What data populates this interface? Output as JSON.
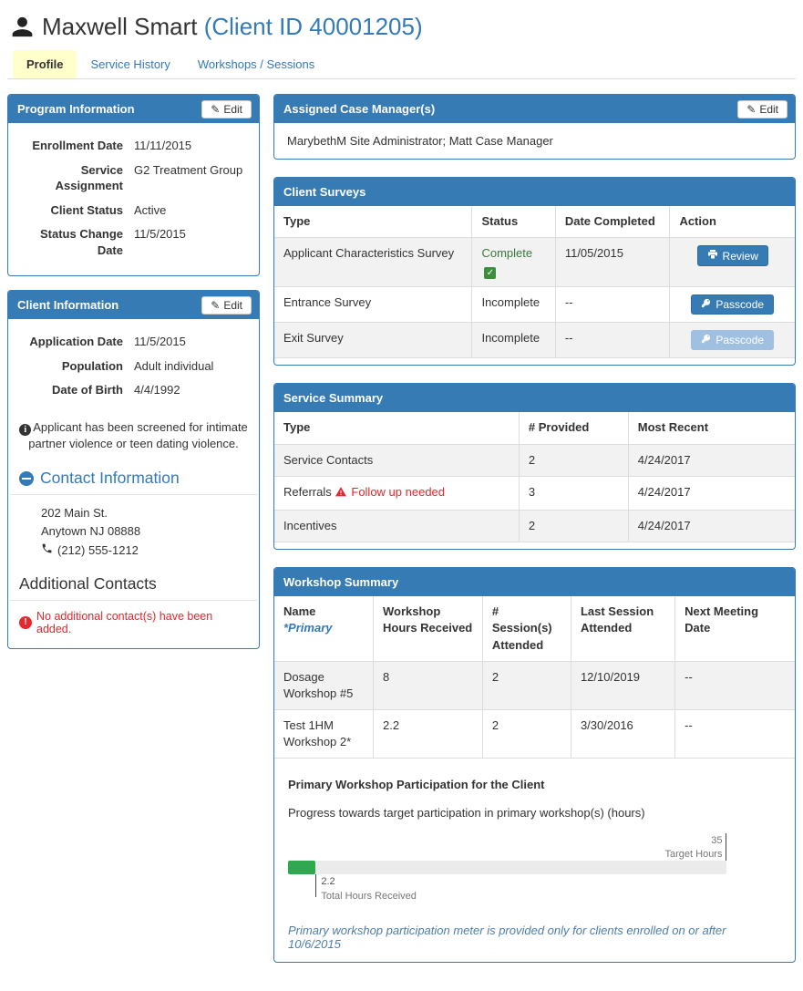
{
  "header": {
    "title": "Maxwell Smart",
    "client_id": "(Client ID 40001205)"
  },
  "tabs": {
    "profile": "Profile",
    "service_history": "Service History",
    "workshops": "Workshops / Sessions"
  },
  "icons": {
    "edit": "✎",
    "check": "✓",
    "info": "i",
    "alert": "!",
    "minus": "minus-circle",
    "user": "person-silhouette",
    "phone": "phone-receiver",
    "review": "printer",
    "passcode": "key",
    "warning": "red-triangle"
  },
  "program_info": {
    "title": "Program Information",
    "edit_label": "Edit",
    "fields": [
      {
        "label": "Enrollment Date",
        "value": "11/11/2015"
      },
      {
        "label": "Service Assignment",
        "value": "G2 Treatment Group"
      },
      {
        "label": "Client Status",
        "value": "Active"
      },
      {
        "label": "Status Change Date",
        "value": "11/5/2015"
      }
    ]
  },
  "client_info": {
    "title": "Client Information",
    "edit_label": "Edit",
    "fields": [
      {
        "label": "Application Date",
        "value": "11/5/2015"
      },
      {
        "label": "Population",
        "value": "Adult individual"
      },
      {
        "label": "Date of Birth",
        "value": "4/4/1992"
      }
    ],
    "screening_note": "Applicant has been screened for intimate partner violence or teen dating violence.",
    "contact": {
      "title": "Contact Information",
      "address_line1": "202 Main St.",
      "address_line2": "Anytown NJ 08888",
      "phone": "(212) 555-1212"
    },
    "additional": {
      "title": "Additional Contacts",
      "empty_message": "No additional contact(s) have been added."
    }
  },
  "case_managers": {
    "title": "Assigned Case Manager(s)",
    "edit_label": "Edit",
    "value": "MarybethM Site Administrator; Matt Case Manager"
  },
  "client_surveys": {
    "title": "Client Surveys",
    "col_type": "Type",
    "col_status": "Status",
    "col_date": "Date Completed",
    "col_action": "Action",
    "rows": [
      {
        "type": "Applicant Characteristics Survey",
        "status": "Complete",
        "date": "11/05/2015",
        "action": "Review"
      },
      {
        "type": "Entrance Survey",
        "status": "Incomplete",
        "date": "--",
        "action": "Passcode"
      },
      {
        "type": "Exit Survey",
        "status": "Incomplete",
        "date": "--",
        "action": "Passcode"
      }
    ]
  },
  "service_summary": {
    "title": "Service Summary",
    "col_type": "Type",
    "col_provided": "# Provided",
    "col_recent": "Most Recent",
    "rows": [
      {
        "type": "Service Contacts",
        "provided": "2",
        "recent": "4/24/2017"
      },
      {
        "type": "Referrals",
        "warning": "Follow up needed",
        "provided": "3",
        "recent": "4/24/2017"
      },
      {
        "type": "Incentives",
        "provided": "2",
        "recent": "4/24/2017"
      }
    ]
  },
  "workshop_summary": {
    "title": "Workshop Summary",
    "col_name": "Name",
    "col_name_note": "*Primary",
    "col_hours": "Workshop Hours Received",
    "col_sessions": "# Session(s) Attended",
    "col_last": "Last Session Attended",
    "col_next": "Next Meeting Date",
    "rows": [
      {
        "name": "Dosage Workshop #5",
        "hours": "8",
        "sessions": "2",
        "last": "12/10/2019",
        "next": "--"
      },
      {
        "name": "Test 1HM Workshop 2*",
        "hours": "2.2",
        "sessions": "2",
        "last": "3/30/2016",
        "next": "--"
      }
    ],
    "participation": {
      "heading": "Primary Workshop Participation for the Client",
      "subheading": "Progress towards target participation in primary workshop(s) (hours)",
      "target_value": "35",
      "target_label": "Target Hours",
      "received_value": "2.2",
      "received_label": "Total Hours Received",
      "fill_style": "width:6.3%",
      "tick_style": "left:6.3%",
      "note": "Primary workshop participation meter is provided only for clients enrolled on or after 10/6/2015"
    }
  },
  "colors": {
    "panel_blue": "#377bb5",
    "link_blue": "#337ab7",
    "tab_yellow": "#ffffcc",
    "complete_green": "#3c763d",
    "check_green": "#3d8e3d",
    "alert_red": "#e8262d",
    "meter_green": "#2fa84f",
    "disabled_button": "#9fc0e0",
    "note_blue": "#4d7ea8"
  }
}
